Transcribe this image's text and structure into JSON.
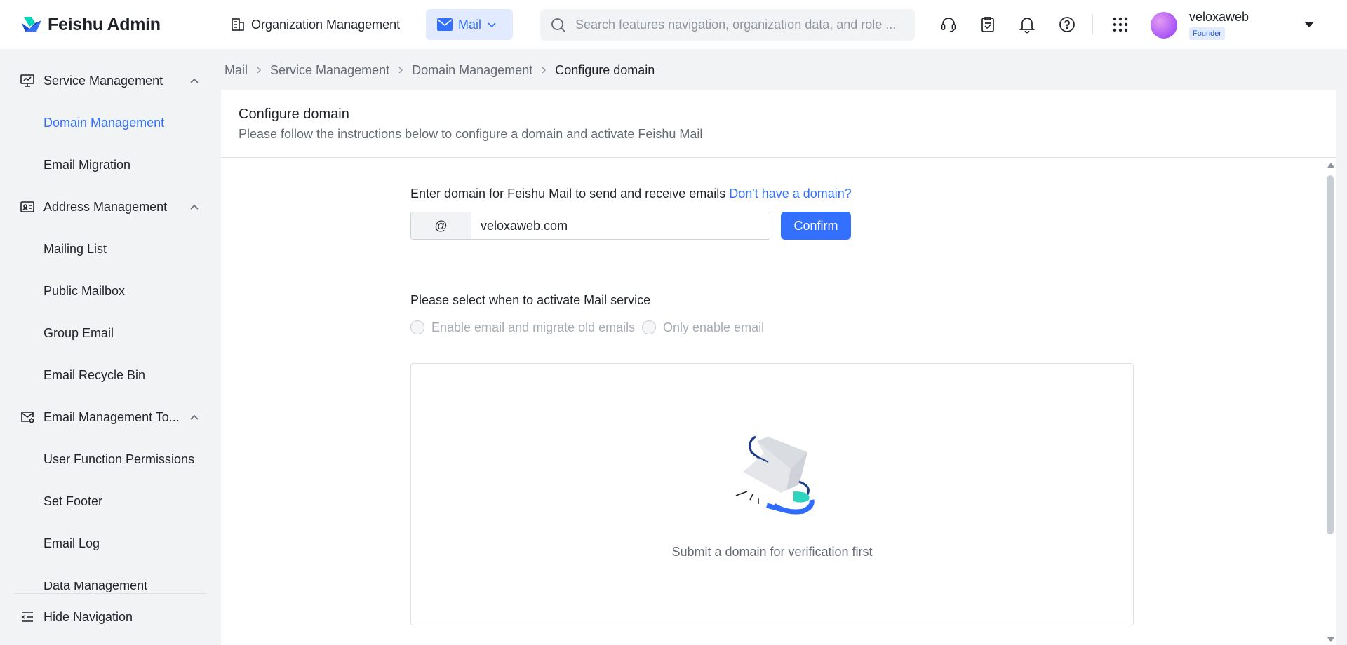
{
  "header": {
    "brand": "Feishu Admin",
    "org_link": "Organization Management",
    "mail_tab": "Mail",
    "search_placeholder": "Search features navigation, organization data, and role ...",
    "user_name": "veloxaweb",
    "user_badge": "Founder"
  },
  "sidebar": {
    "groups": [
      {
        "label": "Service Management",
        "icon": "monitor-icon"
      },
      {
        "label": "Address Management",
        "icon": "contact-card-icon"
      },
      {
        "label": "Email Management To...",
        "icon": "mail-settings-icon"
      }
    ],
    "items": [
      {
        "label": "Domain Management",
        "active": true
      },
      {
        "label": "Email Migration"
      },
      {
        "label": "Mailing List"
      },
      {
        "label": "Public Mailbox"
      },
      {
        "label": "Group Email"
      },
      {
        "label": "Email Recycle Bin"
      },
      {
        "label": "User Function Permissions"
      },
      {
        "label": "Set Footer"
      },
      {
        "label": "Email Log"
      },
      {
        "label": "Data Management"
      }
    ],
    "hide_nav": "Hide Navigation"
  },
  "breadcrumb": [
    "Mail",
    "Service Management",
    "Domain Management",
    "Configure domain"
  ],
  "page": {
    "title": "Configure domain",
    "subtitle": "Please follow the instructions below to configure a domain and activate Feishu Mail",
    "domain_prompt": "Enter domain for Feishu Mail to send and receive emails",
    "domain_link": "Don't have a domain?",
    "at_symbol": "@",
    "domain_value": "veloxaweb.com",
    "confirm_label": "Confirm",
    "activate_label": "Please select when to activate Mail service",
    "radio_options": [
      "Enable email and migrate old emails",
      "Only enable email"
    ],
    "empty_text": "Submit a domain for verification first"
  },
  "colors": {
    "accent": "#3370ff",
    "accent_bg": "#e1eaff",
    "sidebar_bg": "#f2f3f5",
    "panel_bg": "#ffffff"
  }
}
